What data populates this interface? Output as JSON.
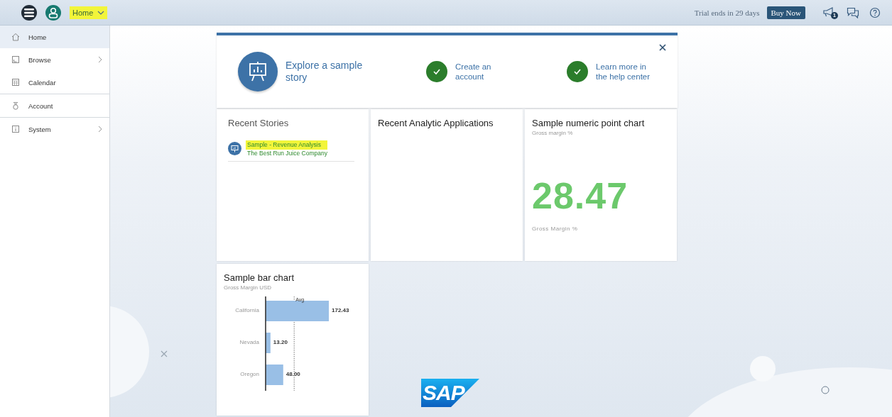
{
  "top_bar": {
    "page_menu": {
      "label": "Home",
      "highlighted": true
    },
    "trial_text": "Trial ends in 29 days",
    "buy_button": "Buy Now",
    "notification_count": "1"
  },
  "sidebar": {
    "items": [
      {
        "label": "Home",
        "selected": true,
        "has_submenu": false,
        "divider_after": false
      },
      {
        "label": "Browse",
        "selected": false,
        "has_submenu": true,
        "divider_after": false
      },
      {
        "label": "Calendar",
        "selected": false,
        "has_submenu": false,
        "divider_after": true
      },
      {
        "label": "Account",
        "selected": false,
        "has_submenu": false,
        "divider_after": true
      },
      {
        "label": "System",
        "selected": false,
        "has_submenu": true,
        "divider_after": false
      }
    ]
  },
  "welcome_banner": {
    "steps": [
      {
        "label": "Explore a sample story",
        "done": false
      },
      {
        "label": "Create an account",
        "done": true
      },
      {
        "label": "Learn more in the help center",
        "done": true
      }
    ]
  },
  "tiles": [
    {
      "kind": "stories",
      "title": "Recent Stories",
      "items": [
        {
          "title": "Sample - Revenue Analysis",
          "subtitle": "The Best Run Juice Company",
          "highlighted": true
        }
      ]
    },
    {
      "kind": "apps",
      "title": "Recent Analytic Applications"
    },
    {
      "kind": "numeric",
      "title": "Sample numeric point chart",
      "subtitle": "Gross margin %",
      "value": "28.47",
      "value_label": "Gross Margin %"
    },
    {
      "kind": "bar",
      "title": "Sample bar chart",
      "subtitle": "Gross Margin USD",
      "chart_data": {
        "type": "bar",
        "orientation": "horizontal",
        "categories": [
          "California",
          "Nevada",
          "Oregon"
        ],
        "values": [
          172.43,
          13.2,
          48.0
        ],
        "value_labels": [
          "172.43",
          "13.20",
          "48.00"
        ],
        "annotations": [
          "Avg"
        ]
      }
    }
  ],
  "logo": {
    "text": "SAP"
  }
}
